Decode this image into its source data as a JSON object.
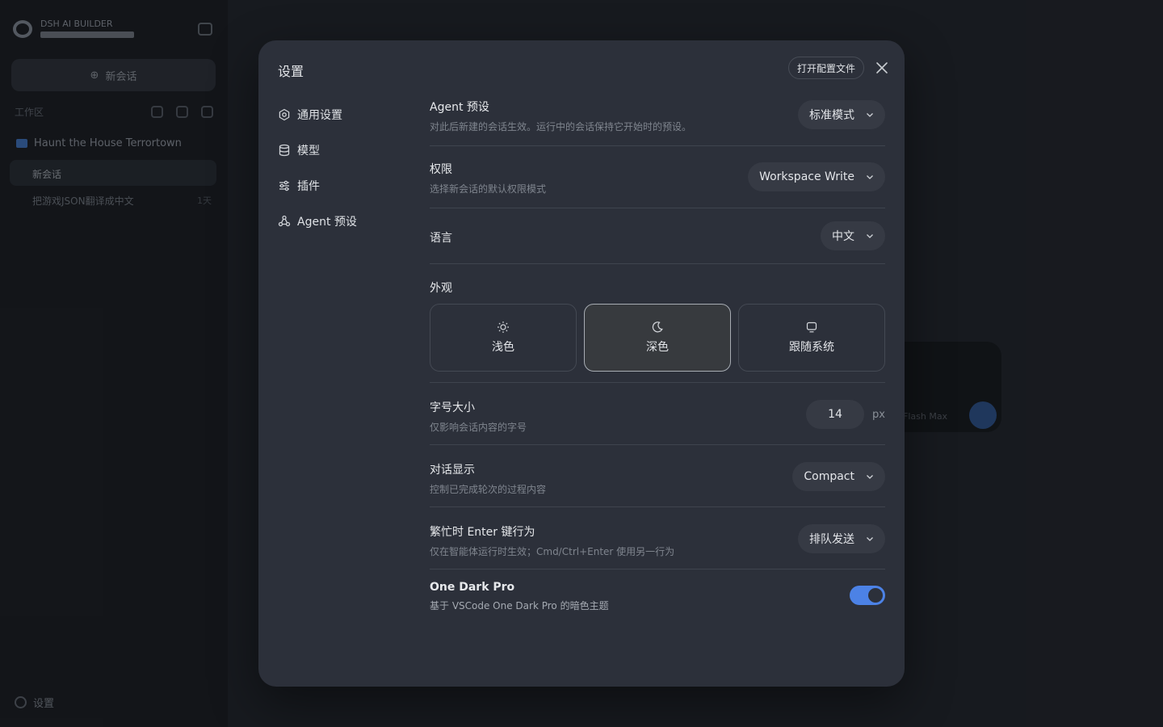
{
  "background": {
    "sidebar": {
      "app_name": "DSH AI BUILDER",
      "new_chat": "新会话",
      "workspace_label": "工作区",
      "project": "Haunt the House Terrortown",
      "active_item": "新会话",
      "item": "把游戏JSON翻译成中文",
      "item_time": "1天",
      "settings": "设置"
    },
    "composer": {
      "model": "Flash Max"
    }
  },
  "modal": {
    "title": "设置",
    "open_config_label": "打开配置文件",
    "nav": [
      {
        "label": "通用设置",
        "icon": "gear-icon"
      },
      {
        "label": "模型",
        "icon": "database-icon"
      },
      {
        "label": "插件",
        "icon": "sliders-icon"
      },
      {
        "label": "Agent 预设",
        "icon": "agent-icon"
      }
    ],
    "settings": {
      "agent_preset": {
        "label": "Agent 预设",
        "desc": "对此后新建的会话生效。运行中的会话保持它开始时的预设。",
        "value": "标准模式"
      },
      "permission": {
        "label": "权限",
        "desc": "选择新会话的默认权限模式",
        "value": "Workspace Write"
      },
      "language": {
        "label": "语言",
        "value": "中文"
      },
      "appearance": {
        "label": "外观",
        "options": [
          {
            "label": "浅色",
            "icon": "sun-icon"
          },
          {
            "label": "深色",
            "icon": "moon-icon"
          },
          {
            "label": "跟随系统",
            "icon": "monitor-icon"
          }
        ],
        "selected": "深色"
      },
      "font_size": {
        "label": "字号大小",
        "desc": "仅影响会话内容的字号",
        "value": "14",
        "unit": "px"
      },
      "chat_display": {
        "label": "对话显示",
        "desc": "控制已完成轮次的过程内容",
        "value": "Compact"
      },
      "busy_enter": {
        "label": "繁忙时 Enter 键行为",
        "desc": "仅在智能体运行时生效；Cmd/Ctrl+Enter 使用另一行为",
        "value": "排队发送"
      },
      "one_dark_pro": {
        "label": "One Dark Pro",
        "desc": "基于 VSCode One Dark Pro 的暗色主题",
        "enabled": true
      }
    }
  },
  "colors": {
    "accent": "#4c82e6",
    "modal_bg": "#2c303a",
    "page_bg": "#1f2228"
  }
}
